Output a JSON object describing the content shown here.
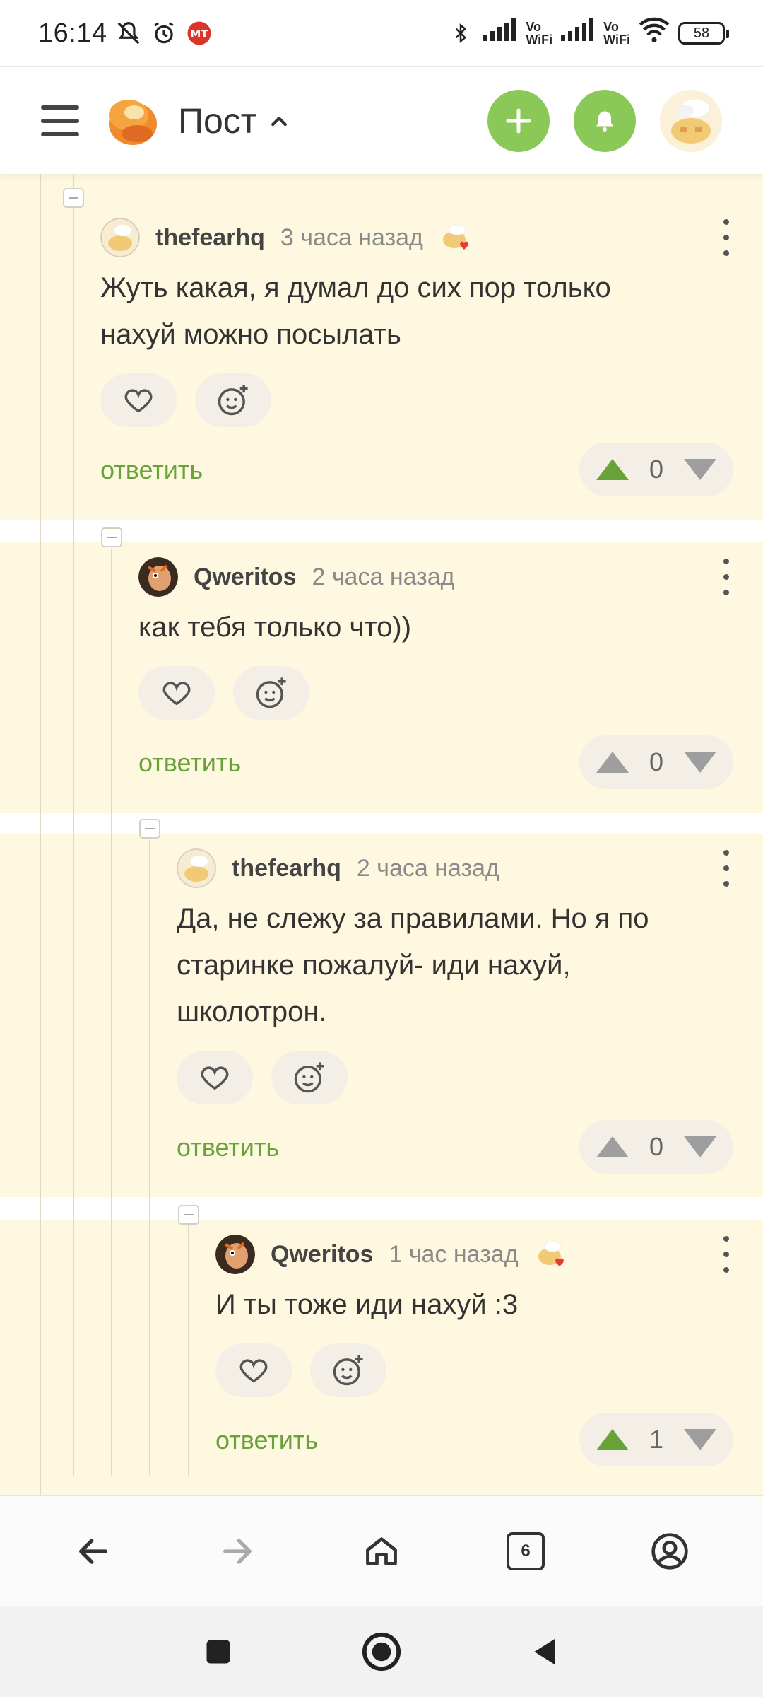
{
  "status_bar": {
    "time": "16:14",
    "vowifi_1": "Vo\nWiFi",
    "vowifi_2": "Vo\nWiFi",
    "battery": "58"
  },
  "header": {
    "title": "Пост",
    "accent_color": "#8ac858"
  },
  "comments": [
    {
      "author": "thefearhq",
      "time": "3 часа назад",
      "text": "Жуть какая, я думал до сих пор только нахуй можно посылать",
      "has_badge": true,
      "reply_label": "ответить",
      "votes": 0,
      "upvoted": true
    },
    {
      "author": "Qweritos",
      "time": "2 часа назад",
      "text": "как тебя только что))",
      "has_badge": false,
      "reply_label": "ответить",
      "votes": 0,
      "upvoted": false
    },
    {
      "author": "thefearhq",
      "time": "2 часа назад",
      "text": "Да, не слежу за правилами. Но я по старинке пожалуй- иди нахуй, школотрон.",
      "has_badge": false,
      "reply_label": "ответить",
      "votes": 0,
      "upvoted": false
    },
    {
      "author": "Qweritos",
      "time": "1 час назад",
      "text": "И ты тоже иди нахуй :3",
      "has_badge": true,
      "reply_label": "ответить",
      "votes": 1,
      "upvoted": true
    }
  ],
  "browser_nav": {
    "tabs_count": "6"
  },
  "icons": [
    "menu-icon",
    "pikabu-logo-icon",
    "chevron-up-icon",
    "plus-icon",
    "bell-icon",
    "heart-icon",
    "add-reaction-icon",
    "upvote-icon",
    "downvote-icon",
    "back-icon",
    "forward-icon",
    "home-icon",
    "tabs-icon",
    "account-icon"
  ]
}
